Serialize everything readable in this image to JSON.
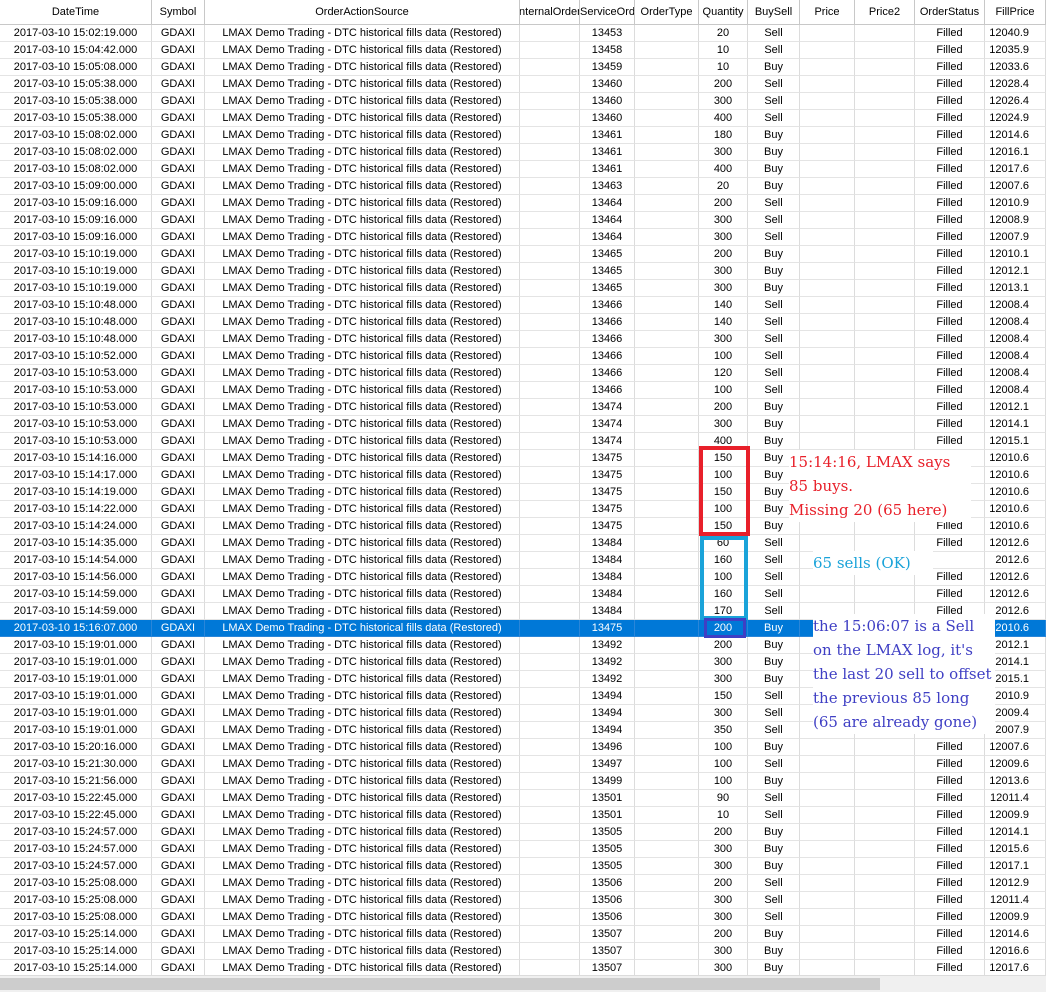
{
  "columns": [
    "DateTime",
    "Symbol",
    "OrderActionSource",
    "InternalOrderID",
    "ServiceOrderID",
    "OrderType",
    "Quantity",
    "BuySell",
    "Price",
    "Price2",
    "OrderStatus",
    "FillPrice"
  ],
  "rows": [
    [
      "2017-03-10 15:02:19.000",
      "GDAXI",
      "LMAX Demo Trading - DTC historical fills data (Restored)",
      "",
      "13453",
      "",
      "20",
      "Sell",
      "",
      "",
      "Filled",
      "12040.9"
    ],
    [
      "2017-03-10 15:04:42.000",
      "GDAXI",
      "LMAX Demo Trading - DTC historical fills data (Restored)",
      "",
      "13458",
      "",
      "10",
      "Sell",
      "",
      "",
      "Filled",
      "12035.9"
    ],
    [
      "2017-03-10 15:05:08.000",
      "GDAXI",
      "LMAX Demo Trading - DTC historical fills data (Restored)",
      "",
      "13459",
      "",
      "10",
      "Buy",
      "",
      "",
      "Filled",
      "12033.6"
    ],
    [
      "2017-03-10 15:05:38.000",
      "GDAXI",
      "LMAX Demo Trading - DTC historical fills data (Restored)",
      "",
      "13460",
      "",
      "200",
      "Sell",
      "",
      "",
      "Filled",
      "12028.4"
    ],
    [
      "2017-03-10 15:05:38.000",
      "GDAXI",
      "LMAX Demo Trading - DTC historical fills data (Restored)",
      "",
      "13460",
      "",
      "300",
      "Sell",
      "",
      "",
      "Filled",
      "12026.4"
    ],
    [
      "2017-03-10 15:05:38.000",
      "GDAXI",
      "LMAX Demo Trading - DTC historical fills data (Restored)",
      "",
      "13460",
      "",
      "400",
      "Sell",
      "",
      "",
      "Filled",
      "12024.9"
    ],
    [
      "2017-03-10 15:08:02.000",
      "GDAXI",
      "LMAX Demo Trading - DTC historical fills data (Restored)",
      "",
      "13461",
      "",
      "180",
      "Buy",
      "",
      "",
      "Filled",
      "12014.6"
    ],
    [
      "2017-03-10 15:08:02.000",
      "GDAXI",
      "LMAX Demo Trading - DTC historical fills data (Restored)",
      "",
      "13461",
      "",
      "300",
      "Buy",
      "",
      "",
      "Filled",
      "12016.1"
    ],
    [
      "2017-03-10 15:08:02.000",
      "GDAXI",
      "LMAX Demo Trading - DTC historical fills data (Restored)",
      "",
      "13461",
      "",
      "400",
      "Buy",
      "",
      "",
      "Filled",
      "12017.6"
    ],
    [
      "2017-03-10 15:09:00.000",
      "GDAXI",
      "LMAX Demo Trading - DTC historical fills data (Restored)",
      "",
      "13463",
      "",
      "20",
      "Buy",
      "",
      "",
      "Filled",
      "12007.6"
    ],
    [
      "2017-03-10 15:09:16.000",
      "GDAXI",
      "LMAX Demo Trading - DTC historical fills data (Restored)",
      "",
      "13464",
      "",
      "200",
      "Sell",
      "",
      "",
      "Filled",
      "12010.9"
    ],
    [
      "2017-03-10 15:09:16.000",
      "GDAXI",
      "LMAX Demo Trading - DTC historical fills data (Restored)",
      "",
      "13464",
      "",
      "300",
      "Sell",
      "",
      "",
      "Filled",
      "12008.9"
    ],
    [
      "2017-03-10 15:09:16.000",
      "GDAXI",
      "LMAX Demo Trading - DTC historical fills data (Restored)",
      "",
      "13464",
      "",
      "300",
      "Sell",
      "",
      "",
      "Filled",
      "12007.9"
    ],
    [
      "2017-03-10 15:10:19.000",
      "GDAXI",
      "LMAX Demo Trading - DTC historical fills data (Restored)",
      "",
      "13465",
      "",
      "200",
      "Buy",
      "",
      "",
      "Filled",
      "12010.1"
    ],
    [
      "2017-03-10 15:10:19.000",
      "GDAXI",
      "LMAX Demo Trading - DTC historical fills data (Restored)",
      "",
      "13465",
      "",
      "300",
      "Buy",
      "",
      "",
      "Filled",
      "12012.1"
    ],
    [
      "2017-03-10 15:10:19.000",
      "GDAXI",
      "LMAX Demo Trading - DTC historical fills data (Restored)",
      "",
      "13465",
      "",
      "300",
      "Buy",
      "",
      "",
      "Filled",
      "12013.1"
    ],
    [
      "2017-03-10 15:10:48.000",
      "GDAXI",
      "LMAX Demo Trading - DTC historical fills data (Restored)",
      "",
      "13466",
      "",
      "140",
      "Sell",
      "",
      "",
      "Filled",
      "12008.4"
    ],
    [
      "2017-03-10 15:10:48.000",
      "GDAXI",
      "LMAX Demo Trading - DTC historical fills data (Restored)",
      "",
      "13466",
      "",
      "140",
      "Sell",
      "",
      "",
      "Filled",
      "12008.4"
    ],
    [
      "2017-03-10 15:10:48.000",
      "GDAXI",
      "LMAX Demo Trading - DTC historical fills data (Restored)",
      "",
      "13466",
      "",
      "300",
      "Sell",
      "",
      "",
      "Filled",
      "12008.4"
    ],
    [
      "2017-03-10 15:10:52.000",
      "GDAXI",
      "LMAX Demo Trading - DTC historical fills data (Restored)",
      "",
      "13466",
      "",
      "100",
      "Sell",
      "",
      "",
      "Filled",
      "12008.4"
    ],
    [
      "2017-03-10 15:10:53.000",
      "GDAXI",
      "LMAX Demo Trading - DTC historical fills data (Restored)",
      "",
      "13466",
      "",
      "120",
      "Sell",
      "",
      "",
      "Filled",
      "12008.4"
    ],
    [
      "2017-03-10 15:10:53.000",
      "GDAXI",
      "LMAX Demo Trading - DTC historical fills data (Restored)",
      "",
      "13466",
      "",
      "100",
      "Sell",
      "",
      "",
      "Filled",
      "12008.4"
    ],
    [
      "2017-03-10 15:10:53.000",
      "GDAXI",
      "LMAX Demo Trading - DTC historical fills data (Restored)",
      "",
      "13474",
      "",
      "200",
      "Buy",
      "",
      "",
      "Filled",
      "12012.1"
    ],
    [
      "2017-03-10 15:10:53.000",
      "GDAXI",
      "LMAX Demo Trading - DTC historical fills data (Restored)",
      "",
      "13474",
      "",
      "300",
      "Buy",
      "",
      "",
      "Filled",
      "12014.1"
    ],
    [
      "2017-03-10 15:10:53.000",
      "GDAXI",
      "LMAX Demo Trading - DTC historical fills data (Restored)",
      "",
      "13474",
      "",
      "400",
      "Buy",
      "",
      "",
      "Filled",
      "12015.1"
    ],
    [
      "2017-03-10 15:14:16.000",
      "GDAXI",
      "LMAX Demo Trading - DTC historical fills data (Restored)",
      "",
      "13475",
      "",
      "150",
      "Buy",
      "",
      "",
      "Filled",
      "12010.6"
    ],
    [
      "2017-03-10 15:14:17.000",
      "GDAXI",
      "LMAX Demo Trading - DTC historical fills data (Restored)",
      "",
      "13475",
      "",
      "100",
      "Buy",
      "",
      "",
      "Filled",
      "12010.6"
    ],
    [
      "2017-03-10 15:14:19.000",
      "GDAXI",
      "LMAX Demo Trading - DTC historical fills data (Restored)",
      "",
      "13475",
      "",
      "150",
      "Buy",
      "",
      "",
      "Filled",
      "12010.6"
    ],
    [
      "2017-03-10 15:14:22.000",
      "GDAXI",
      "LMAX Demo Trading - DTC historical fills data (Restored)",
      "",
      "13475",
      "",
      "100",
      "Buy",
      "",
      "",
      "Filled",
      "12010.6"
    ],
    [
      "2017-03-10 15:14:24.000",
      "GDAXI",
      "LMAX Demo Trading - DTC historical fills data (Restored)",
      "",
      "13475",
      "",
      "150",
      "Buy",
      "",
      "",
      "Filled",
      "12010.6"
    ],
    [
      "2017-03-10 15:14:35.000",
      "GDAXI",
      "LMAX Demo Trading - DTC historical fills data (Restored)",
      "",
      "13484",
      "",
      "60",
      "Sell",
      "",
      "",
      "Filled",
      "12012.6"
    ],
    [
      "2017-03-10 15:14:54.000",
      "GDAXI",
      "LMAX Demo Trading - DTC historical fills data (Restored)",
      "",
      "13484",
      "",
      "160",
      "Sell",
      "",
      "",
      "",
      "2012.6"
    ],
    [
      "2017-03-10 15:14:56.000",
      "GDAXI",
      "LMAX Demo Trading - DTC historical fills data (Restored)",
      "",
      "13484",
      "",
      "100",
      "Sell",
      "",
      "",
      "Filled",
      "12012.6"
    ],
    [
      "2017-03-10 15:14:59.000",
      "GDAXI",
      "LMAX Demo Trading - DTC historical fills data (Restored)",
      "",
      "13484",
      "",
      "160",
      "Sell",
      "",
      "",
      "Filled",
      "12012.6"
    ],
    [
      "2017-03-10 15:14:59.000",
      "GDAXI",
      "LMAX Demo Trading - DTC historical fills data (Restored)",
      "",
      "13484",
      "",
      "170",
      "Sell",
      "",
      "",
      "Filled",
      "2012.6"
    ],
    [
      "2017-03-10 15:16:07.000",
      "GDAXI",
      "LMAX Demo Trading - DTC historical fills data (Restored)",
      "",
      "13475",
      "",
      "200",
      "Buy",
      "",
      "",
      "",
      "2010.6"
    ],
    [
      "2017-03-10 15:19:01.000",
      "GDAXI",
      "LMAX Demo Trading - DTC historical fills data (Restored)",
      "",
      "13492",
      "",
      "200",
      "Buy",
      "",
      "",
      "",
      "2012.1"
    ],
    [
      "2017-03-10 15:19:01.000",
      "GDAXI",
      "LMAX Demo Trading - DTC historical fills data (Restored)",
      "",
      "13492",
      "",
      "300",
      "Buy",
      "",
      "",
      "",
      "2014.1"
    ],
    [
      "2017-03-10 15:19:01.000",
      "GDAXI",
      "LMAX Demo Trading - DTC historical fills data (Restored)",
      "",
      "13492",
      "",
      "300",
      "Buy",
      "",
      "",
      "",
      "2015.1"
    ],
    [
      "2017-03-10 15:19:01.000",
      "GDAXI",
      "LMAX Demo Trading - DTC historical fills data (Restored)",
      "",
      "13494",
      "",
      "150",
      "Sell",
      "",
      "",
      "",
      "2010.9"
    ],
    [
      "2017-03-10 15:19:01.000",
      "GDAXI",
      "LMAX Demo Trading - DTC historical fills data (Restored)",
      "",
      "13494",
      "",
      "300",
      "Sell",
      "",
      "",
      "",
      "2009.4"
    ],
    [
      "2017-03-10 15:19:01.000",
      "GDAXI",
      "LMAX Demo Trading - DTC historical fills data (Restored)",
      "",
      "13494",
      "",
      "350",
      "Sell",
      "",
      "",
      "",
      "2007.9"
    ],
    [
      "2017-03-10 15:20:16.000",
      "GDAXI",
      "LMAX Demo Trading - DTC historical fills data (Restored)",
      "",
      "13496",
      "",
      "100",
      "Buy",
      "",
      "",
      "Filled",
      "12007.6"
    ],
    [
      "2017-03-10 15:21:30.000",
      "GDAXI",
      "LMAX Demo Trading - DTC historical fills data (Restored)",
      "",
      "13497",
      "",
      "100",
      "Sell",
      "",
      "",
      "Filled",
      "12009.6"
    ],
    [
      "2017-03-10 15:21:56.000",
      "GDAXI",
      "LMAX Demo Trading - DTC historical fills data (Restored)",
      "",
      "13499",
      "",
      "100",
      "Buy",
      "",
      "",
      "Filled",
      "12013.6"
    ],
    [
      "2017-03-10 15:22:45.000",
      "GDAXI",
      "LMAX Demo Trading - DTC historical fills data (Restored)",
      "",
      "13501",
      "",
      "90",
      "Sell",
      "",
      "",
      "Filled",
      "12011.4"
    ],
    [
      "2017-03-10 15:22:45.000",
      "GDAXI",
      "LMAX Demo Trading - DTC historical fills data (Restored)",
      "",
      "13501",
      "",
      "10",
      "Sell",
      "",
      "",
      "Filled",
      "12009.9"
    ],
    [
      "2017-03-10 15:24:57.000",
      "GDAXI",
      "LMAX Demo Trading - DTC historical fills data (Restored)",
      "",
      "13505",
      "",
      "200",
      "Buy",
      "",
      "",
      "Filled",
      "12014.1"
    ],
    [
      "2017-03-10 15:24:57.000",
      "GDAXI",
      "LMAX Demo Trading - DTC historical fills data (Restored)",
      "",
      "13505",
      "",
      "300",
      "Buy",
      "",
      "",
      "Filled",
      "12015.6"
    ],
    [
      "2017-03-10 15:24:57.000",
      "GDAXI",
      "LMAX Demo Trading - DTC historical fills data (Restored)",
      "",
      "13505",
      "",
      "300",
      "Buy",
      "",
      "",
      "Filled",
      "12017.1"
    ],
    [
      "2017-03-10 15:25:08.000",
      "GDAXI",
      "LMAX Demo Trading - DTC historical fills data (Restored)",
      "",
      "13506",
      "",
      "200",
      "Sell",
      "",
      "",
      "Filled",
      "12012.9"
    ],
    [
      "2017-03-10 15:25:08.000",
      "GDAXI",
      "LMAX Demo Trading - DTC historical fills data (Restored)",
      "",
      "13506",
      "",
      "300",
      "Sell",
      "",
      "",
      "Filled",
      "12011.4"
    ],
    [
      "2017-03-10 15:25:08.000",
      "GDAXI",
      "LMAX Demo Trading - DTC historical fills data (Restored)",
      "",
      "13506",
      "",
      "300",
      "Sell",
      "",
      "",
      "Filled",
      "12009.9"
    ],
    [
      "2017-03-10 15:25:14.000",
      "GDAXI",
      "LMAX Demo Trading - DTC historical fills data (Restored)",
      "",
      "13507",
      "",
      "200",
      "Buy",
      "",
      "",
      "Filled",
      "12014.6"
    ],
    [
      "2017-03-10 15:25:14.000",
      "GDAXI",
      "LMAX Demo Trading - DTC historical fills data (Restored)",
      "",
      "13507",
      "",
      "300",
      "Buy",
      "",
      "",
      "Filled",
      "12016.6"
    ],
    [
      "2017-03-10 15:25:14.000",
      "GDAXI",
      "LMAX Demo Trading - DTC historical fills data (Restored)",
      "",
      "13507",
      "",
      "300",
      "Buy",
      "",
      "",
      "Filled",
      "12017.6"
    ]
  ],
  "selected_row_index": 35,
  "annotations": {
    "red_note": "15:14:16, LMAX says\n85 buys.\nMissing 20 (65 here)",
    "cyan_note": "65 sells (OK)",
    "blue_note": "the 15:06:07 is a Sell\non the LMAX log, it's\nthe last 20 sell to offset\nthe previous 85 long\n(65 are already gone)"
  },
  "colors": {
    "selection": "#0078d7",
    "red_annotation": "#e8202a",
    "cyan_annotation": "#1aa3d9",
    "blue_annotation": "#3f3fc4"
  }
}
